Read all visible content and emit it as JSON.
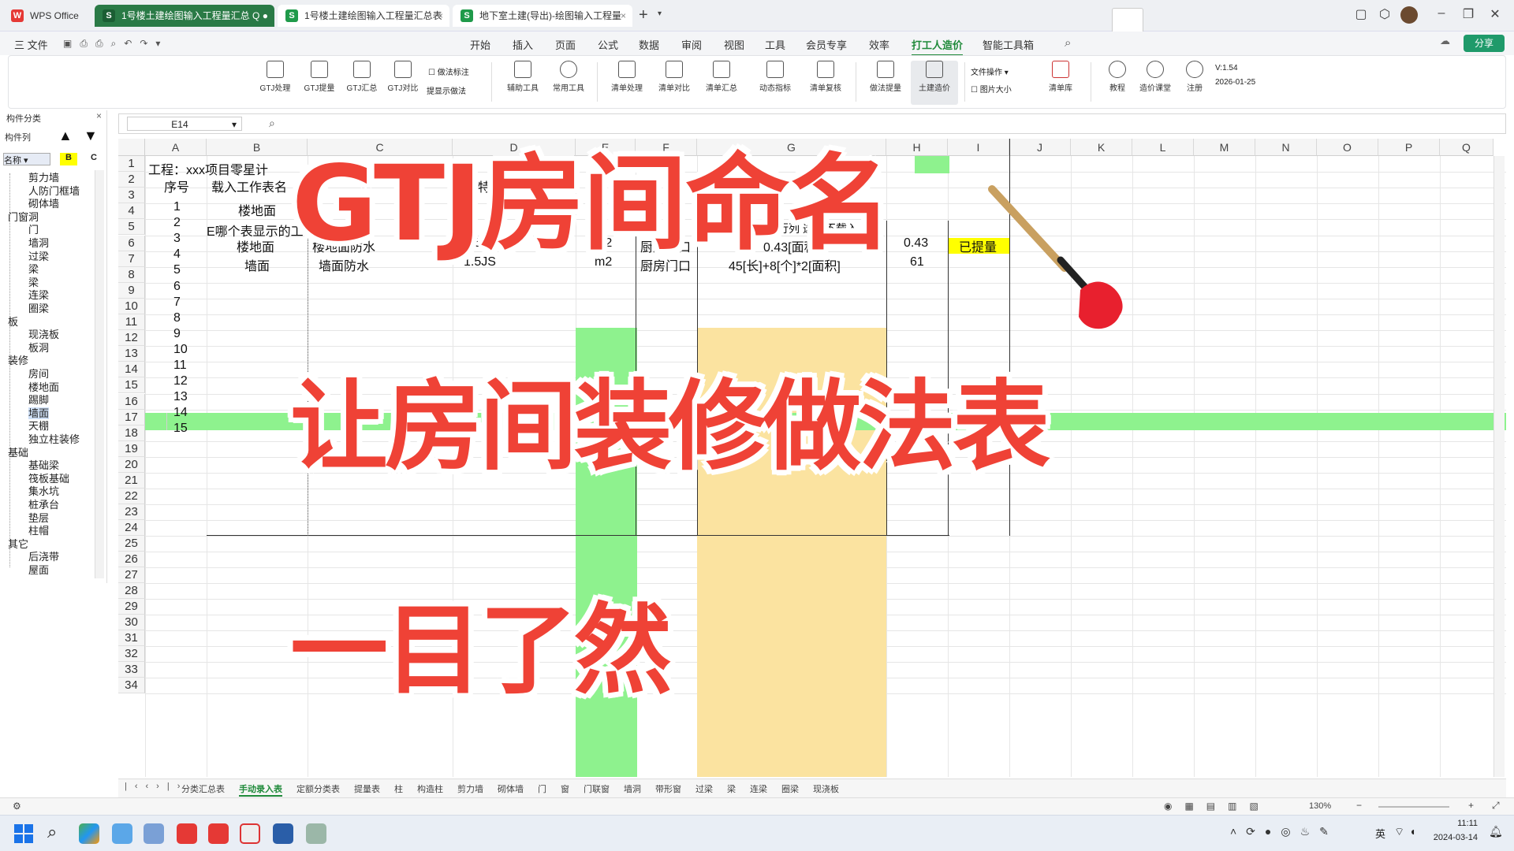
{
  "titlebar": {
    "tabs": [
      {
        "label": "WPS Office",
        "icon": "W"
      },
      {
        "label": "1号楼土建绘图输入工程量汇总 Q",
        "icon": "S"
      },
      {
        "label": "1号楼土建绘图输入工程量汇总表",
        "icon": "S"
      },
      {
        "label": "地下室土建(导出)-绘图输入工程量",
        "icon": "S"
      }
    ],
    "new_tab": "+",
    "open_btn": "开始"
  },
  "menu": {
    "file": "三 文件",
    "items": [
      "开始",
      "插入",
      "页面",
      "公式",
      "数据",
      "审阅",
      "视图",
      "工具",
      "会员专享",
      "效率",
      "打工人造价",
      "智能工具箱"
    ],
    "active": "打工人造价",
    "share": "分享"
  },
  "ribbon": {
    "buttons": [
      "GTJ处理",
      "GTJ提量",
      "GTJ汇总",
      "GTJ对比",
      "辅助工具",
      "常用工具",
      "清单处理",
      "清单对比",
      "清单汇总",
      "动态指标",
      "清单复核",
      "做法提量",
      "土建造价",
      "清单库",
      "教程",
      "造价课堂",
      "注册"
    ],
    "checks": [
      "做法标注",
      "提显示做法",
      "图片大小"
    ],
    "file_ops": "文件操作",
    "version": "V:1.54",
    "date": "2026-01-25"
  },
  "leftpanel": {
    "header": "构件分类",
    "header2": "构件列",
    "filter": "名称",
    "btnB": "B",
    "btnC": "C",
    "tree": [
      "剪力墙",
      "人防门框墙",
      "砌体墙",
      "门窗洞",
      "门",
      "墙洞",
      "过梁",
      "梁",
      "梁",
      "连梁",
      "圈梁",
      "板",
      "现浇板",
      "板洞",
      "装修",
      "房间",
      "楼地面",
      "踢脚",
      "墙面",
      "天棚",
      "独立柱装修",
      "基础",
      "基础梁",
      "筏板基础",
      "集水坑",
      "桩承台",
      "垫层",
      "柱帽",
      "其它",
      "后浇带",
      "屋面"
    ]
  },
  "formulabar": {
    "cellref": "E14",
    "value": ""
  },
  "sheet": {
    "columns": [
      "A",
      "B",
      "C",
      "D",
      "E",
      "F",
      "G",
      "H",
      "I",
      "J",
      "K",
      "L",
      "M",
      "N",
      "O",
      "P",
      "Q"
    ],
    "rows": [
      "1",
      "2",
      "3",
      "4",
      "5",
      "6",
      "7",
      "8",
      "9",
      "10",
      "11",
      "12",
      "13",
      "14",
      "15",
      "16",
      "17",
      "18",
      "19",
      "20",
      "21",
      "22",
      "23",
      "24",
      "25",
      "26",
      "27",
      "28",
      "29",
      "30",
      "31",
      "32",
      "33",
      "34"
    ],
    "r1": "工程：xxx项目零星计",
    "header": {
      "seq": "序号",
      "sheet": "载入工作表名",
      "item": "项目特"
    },
    "seqs": [
      "1",
      "2",
      "3",
      "4",
      "5",
      "6",
      "7",
      "8",
      "9",
      "10",
      "11",
      "12",
      "13",
      "14",
      "15"
    ],
    "r3b": "楼地面",
    "r4": "E哪个表显示的工作表名",
    "r4_note": "不想载入，表格行列 选中不载入",
    "r5": {
      "b": "楼地面",
      "c": "楼地面防水",
      "d": "1.5JS",
      "f": "m2",
      "g": "厨房门口",
      "h": "0.43[面积]",
      "i": "0.43",
      "j": "已提量"
    },
    "r6": {
      "b": "墙面",
      "c": "墙面防水",
      "d": "1.5JS",
      "f": "m2",
      "g": "厨房门口",
      "h": "45[长]+8[个]*2[面积]",
      "i": "61"
    }
  },
  "sheettabs": [
    "分类汇总表",
    "手动录入表",
    "定额分类表",
    "提量表",
    "柱",
    "构造柱",
    "剪力墙",
    "砌体墙",
    "门",
    "窗",
    "门联窗",
    "墙洞",
    "带形窗",
    "过梁",
    "梁",
    "连梁",
    "圈梁",
    "现浇板"
  ],
  "active_sheet": "手动录入表",
  "status": {
    "zoom": "130%"
  },
  "taskbar": {
    "time": "11:11",
    "date": "2024-03-14",
    "ime": "英"
  },
  "overlay": {
    "line1": "GTJ房间命名",
    "line2": "让房间装修做法表",
    "line3": "一目了然"
  },
  "colors": {
    "green": "#8ef28e",
    "yellow": "#fbe3a0",
    "red": "#ef4236",
    "accent": "#1f8a3a"
  }
}
